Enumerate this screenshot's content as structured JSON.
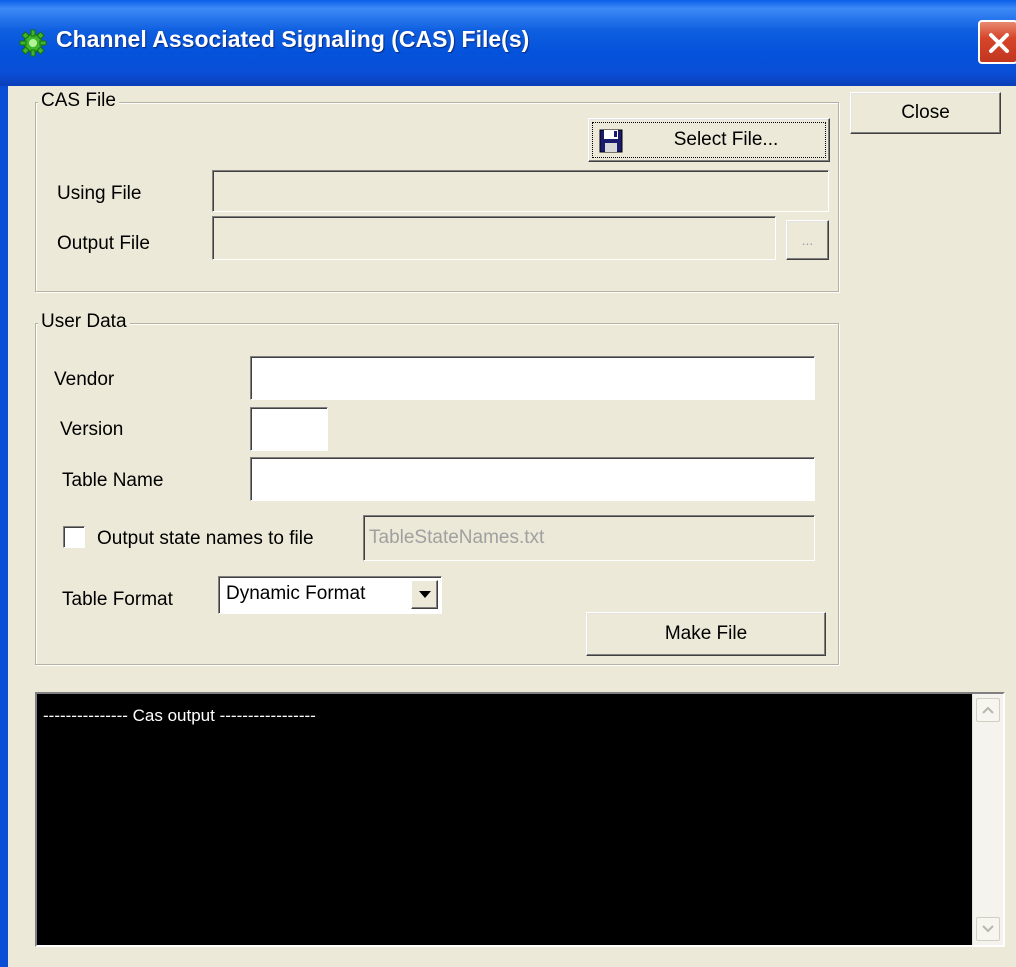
{
  "window": {
    "title": "Channel Associated Signaling (CAS) File(s)",
    "close_icon": "close-x-icon",
    "app_icon": "green-gear-icon"
  },
  "buttons": {
    "close": "Close",
    "select_file": "Select File...",
    "browse": "...",
    "make_file": "Make File"
  },
  "cas_file": {
    "group_label": "CAS File",
    "using_file_label": "Using File",
    "using_file_value": "",
    "output_file_label": "Output File",
    "output_file_value": ""
  },
  "user_data": {
    "group_label": "User Data",
    "vendor_label": "Vendor",
    "vendor_value": "",
    "version_label": "Version",
    "version_value": "",
    "table_name_label": "Table Name",
    "table_name_value": "",
    "output_state_names_label": "Output state names to file",
    "output_state_names_checked": false,
    "state_names_file": "TableStateNames.txt",
    "table_format_label": "Table Format",
    "table_format_value": "Dynamic Format"
  },
  "console": {
    "text": "--------------- Cas output -----------------"
  },
  "colors": {
    "titlebar": "#0a4ed6",
    "dialog_bg": "#ece9d8",
    "console_bg": "#000000",
    "console_text": "#ffffff"
  }
}
